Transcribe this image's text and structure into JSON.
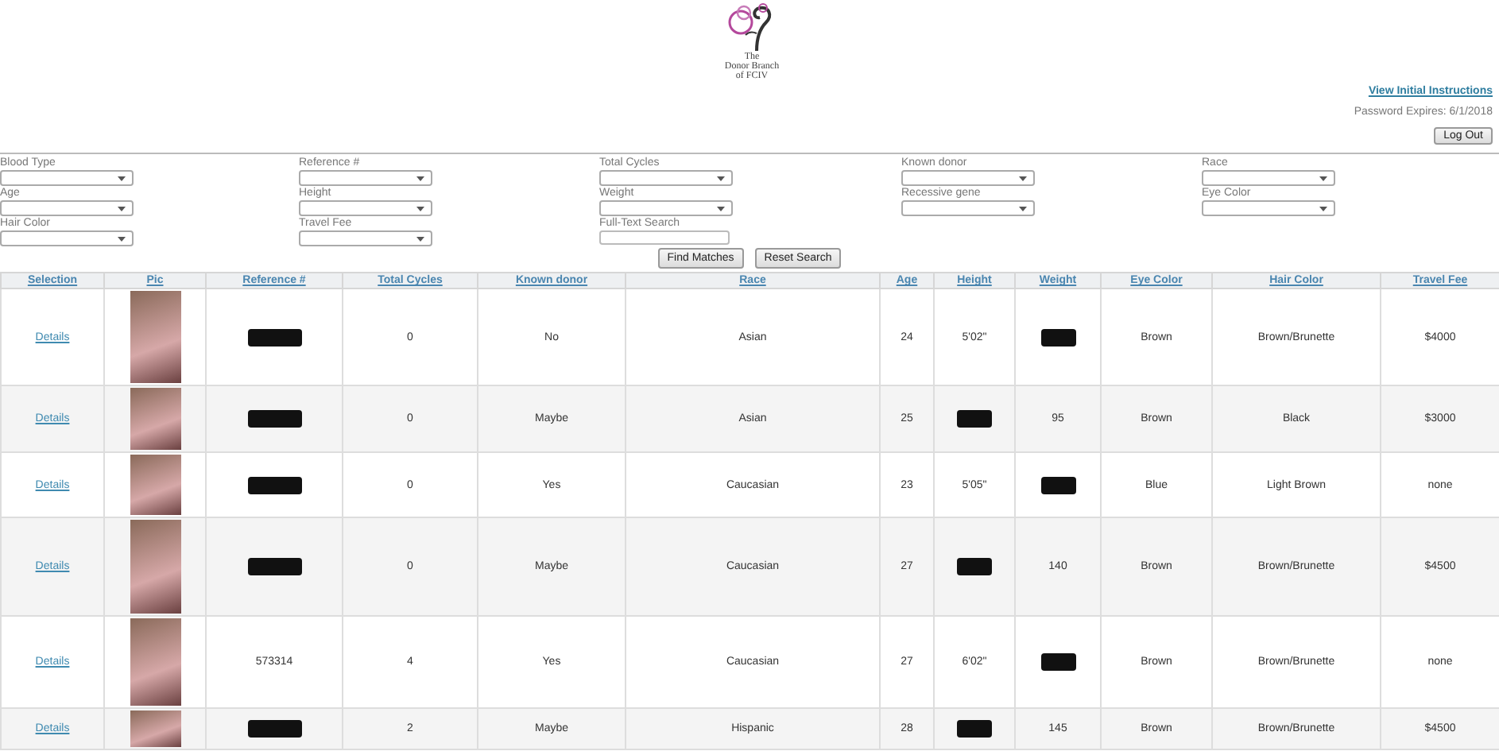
{
  "logo": {
    "lines": [
      "The",
      "Donor Branch",
      "of FCIV"
    ]
  },
  "header": {
    "instructions_link": "View Initial Instructions",
    "password_expires": "Password Expires: 6/1/2018",
    "logout_button": "Log Out"
  },
  "filters": [
    {
      "label": "Blood Type",
      "kind": "select"
    },
    {
      "label": "Reference #",
      "kind": "select"
    },
    {
      "label": "Total Cycles",
      "kind": "select"
    },
    {
      "label": "Known donor",
      "kind": "select"
    },
    {
      "label": "Race",
      "kind": "select"
    },
    {
      "label": "Age",
      "kind": "select"
    },
    {
      "label": "Height",
      "kind": "select"
    },
    {
      "label": "Weight",
      "kind": "select"
    },
    {
      "label": "Recessive gene",
      "kind": "select"
    },
    {
      "label": "Eye Color",
      "kind": "select"
    },
    {
      "label": "Hair Color",
      "kind": "select"
    },
    {
      "label": "Travel Fee",
      "kind": "select"
    },
    {
      "label": "Full-Text Search",
      "kind": "text"
    }
  ],
  "search_buttons": [
    "Find Matches",
    "Reset Search"
  ],
  "table": {
    "columns": [
      "Selection",
      "Pic",
      "Reference #",
      "Total Cycles",
      "Known donor",
      "Race",
      "Age",
      "Height",
      "Weight",
      "Eye Color",
      "Hair Color",
      "Travel Fee"
    ],
    "rows": [
      {
        "link": "Details",
        "reference": null,
        "total_cycles": "0",
        "known_donor": "No",
        "race": "Asian",
        "age": "24",
        "height": "5'02\"",
        "weight": null,
        "eye_color": "Brown",
        "hair_color": "Brown/Brunette",
        "travel_fee": "$4000"
      },
      {
        "link": "Details",
        "reference": null,
        "total_cycles": "0",
        "known_donor": "Maybe",
        "race": "Asian",
        "age": "25",
        "height": null,
        "weight": "95",
        "eye_color": "Brown",
        "hair_color": "Black",
        "travel_fee": "$3000"
      },
      {
        "link": "Details",
        "reference": null,
        "total_cycles": "0",
        "known_donor": "Yes",
        "race": "Caucasian",
        "age": "23",
        "height": "5'05\"",
        "weight": null,
        "eye_color": "Blue",
        "hair_color": "Light Brown",
        "travel_fee": "none"
      },
      {
        "link": "Details",
        "reference": null,
        "total_cycles": "0",
        "known_donor": "Maybe",
        "race": "Caucasian",
        "age": "27",
        "height": null,
        "weight": "140",
        "eye_color": "Brown",
        "hair_color": "Brown/Brunette",
        "travel_fee": "$4500"
      },
      {
        "link": "Details",
        "reference": "573314",
        "total_cycles": "4",
        "known_donor": "Yes",
        "race": "Caucasian",
        "age": "27",
        "height": "6'02\"",
        "weight": null,
        "eye_color": "Brown",
        "hair_color": "Brown/Brunette",
        "travel_fee": "none"
      },
      {
        "link": "Details",
        "reference": null,
        "total_cycles": "2",
        "known_donor": "Maybe",
        "race": "Hispanic",
        "age": "28",
        "height": null,
        "weight": "145",
        "eye_color": "Brown",
        "hair_color": "Brown/Brunette",
        "travel_fee": "$4500"
      }
    ]
  }
}
